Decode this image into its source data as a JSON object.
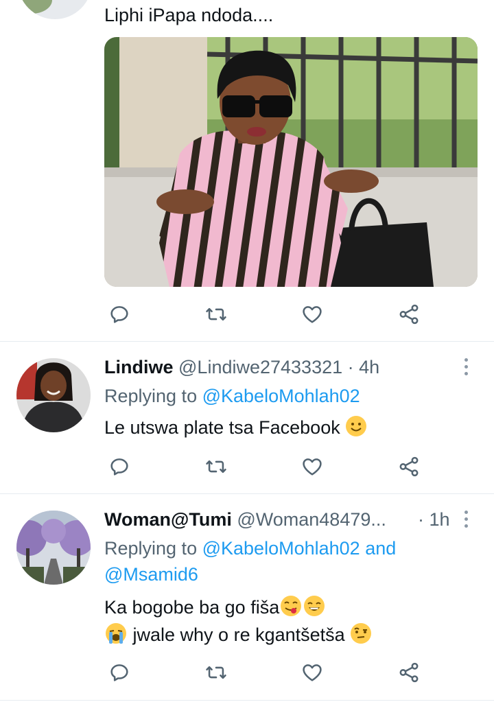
{
  "tweet1": {
    "text": "Liphi iPapa ndoda...."
  },
  "reply1": {
    "name": "Lindiwe",
    "handle": "@Lindiwe27433321",
    "separator": "·",
    "time": "4h",
    "replying_prefix": "Replying to",
    "replying_to": "@KabeloMohlah02",
    "text": "Le utswa plate tsa Facebook"
  },
  "reply2": {
    "name": "Woman@Tumi",
    "handle": "@Woman48479...",
    "separator": "·",
    "time": "1h",
    "replying_prefix": "Replying to",
    "replying_to": "@KabeloMohlah02",
    "and_word": "and",
    "replying_to_2": "@Msamid6",
    "line1": "Ka bogobe ba go fiša",
    "line2": "jwale why o re kgantšetša"
  },
  "icons": {
    "reply": "reply-icon",
    "retweet": "retweet-icon",
    "like": "heart-icon",
    "share": "share-icon",
    "more": "more-icon"
  },
  "colors": {
    "text": "#0f1419",
    "muted": "#536471",
    "link": "#1d9bf0",
    "divider": "#e6ecf0",
    "icon": "#536471"
  }
}
